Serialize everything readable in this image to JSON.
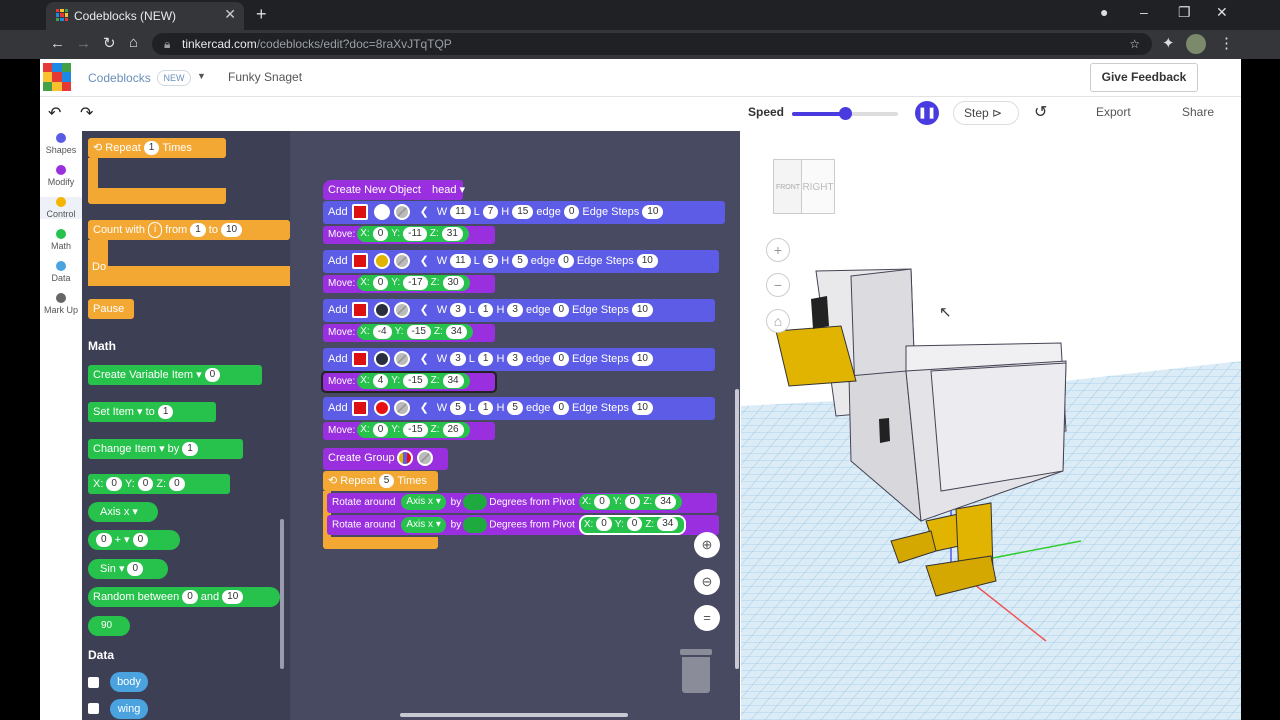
{
  "browser": {
    "tab_title": "Codeblocks (NEW)",
    "url_host": "tinkercad.com",
    "url_path": "/codeblocks/edit?doc=8raXvJTqTQP"
  },
  "app": {
    "name": "Codeblocks",
    "badge": "NEW",
    "doc_name": "Funky Snaget",
    "feedback": "Give Feedback"
  },
  "toolbar": {
    "speed_label": "Speed",
    "speed_value": 0.5,
    "step": "Step",
    "export": "Export",
    "share": "Share"
  },
  "categories": [
    {
      "label": "Shapes",
      "color": "#5a5ce6"
    },
    {
      "label": "Modify",
      "color": "#9a2fe0"
    },
    {
      "label": "Control",
      "color": "#f4b400"
    },
    {
      "label": "Math",
      "color": "#27c24c"
    },
    {
      "label": "Data",
      "color": "#4aa3df"
    },
    {
      "label": "Mark Up",
      "color": "#666666"
    }
  ],
  "flyout": {
    "repeat": {
      "label": "Repeat",
      "n": "1",
      "times": "Times"
    },
    "count": {
      "label": "Count with",
      "var": "i",
      "from": "from",
      "a": "1",
      "to": "to",
      "b": "10",
      "do": "Do"
    },
    "pause": "Pause",
    "math_header": "Math",
    "create_var": {
      "label": "Create Variable",
      "var": "Item",
      "val": "0"
    },
    "set": {
      "label": "Set",
      "var": "Item",
      "to": "to",
      "val": "1"
    },
    "change": {
      "label": "Change",
      "var": "Item",
      "by": "by",
      "val": "1"
    },
    "xyz": {
      "x": "X:",
      "xv": "0",
      "y": "Y:",
      "yv": "0",
      "z": "Z:",
      "zv": "0"
    },
    "axis": "Axis x",
    "arith": {
      "a": "0",
      "op": "+",
      "b": "0"
    },
    "sin": {
      "fn": "Sin",
      "v": "0"
    },
    "random": {
      "label": "Random between",
      "a": "0",
      "and": "and",
      "b": "10"
    },
    "num": "90",
    "data_header": "Data",
    "vars": [
      "body",
      "wing"
    ]
  },
  "program": {
    "create": {
      "label": "Create New Object",
      "name": "head"
    },
    "rows": [
      {
        "add": "Add",
        "color": "#ffffff",
        "w": "11",
        "l": "7",
        "h": "15",
        "edge": "0",
        "steps": "10",
        "mx": "0",
        "my": "-11",
        "mz": "31"
      },
      {
        "add": "Add",
        "color": "#e0b400",
        "w": "11",
        "l": "5",
        "h": "5",
        "edge": "0",
        "steps": "10",
        "mx": "0",
        "my": "-17",
        "mz": "30"
      },
      {
        "add": "Add",
        "color": "#2a2f3f",
        "w": "3",
        "l": "1",
        "h": "3",
        "edge": "0",
        "steps": "10",
        "mx": "-4",
        "my": "-15",
        "mz": "34"
      },
      {
        "add": "Add",
        "color": "#2a2f3f",
        "w": "3",
        "l": "1",
        "h": "3",
        "edge": "0",
        "steps": "10",
        "mx": "4",
        "my": "-15",
        "mz": "34"
      },
      {
        "add": "Add",
        "color": "#e81010",
        "w": "5",
        "l": "1",
        "h": "5",
        "edge": "0",
        "steps": "10",
        "mx": "0",
        "my": "-15",
        "mz": "26"
      }
    ],
    "labels": {
      "w": "W",
      "l": "L",
      "h": "H",
      "edge": "edge",
      "steps": "Edge Steps",
      "move": "Move:",
      "x": "X:",
      "y": "Y:",
      "z": "Z:"
    },
    "group": "Create Group",
    "repeat": {
      "label": "Repeat",
      "n": "5",
      "times": "Times"
    },
    "rotates": [
      {
        "label": "Rotate around",
        "axis": "Axis x",
        "by": "by",
        "deg": "Degrees",
        "pivot": "from Pivot",
        "x": "0",
        "y": "0",
        "z": "34"
      },
      {
        "label": "Rotate around",
        "axis": "Axis x",
        "by": "by",
        "deg": "Degrees",
        "pivot": "from Pivot",
        "x": "0",
        "y": "0",
        "z": "34"
      }
    ]
  },
  "viewcube": {
    "front": "FRONT",
    "right": "RIGHT"
  }
}
